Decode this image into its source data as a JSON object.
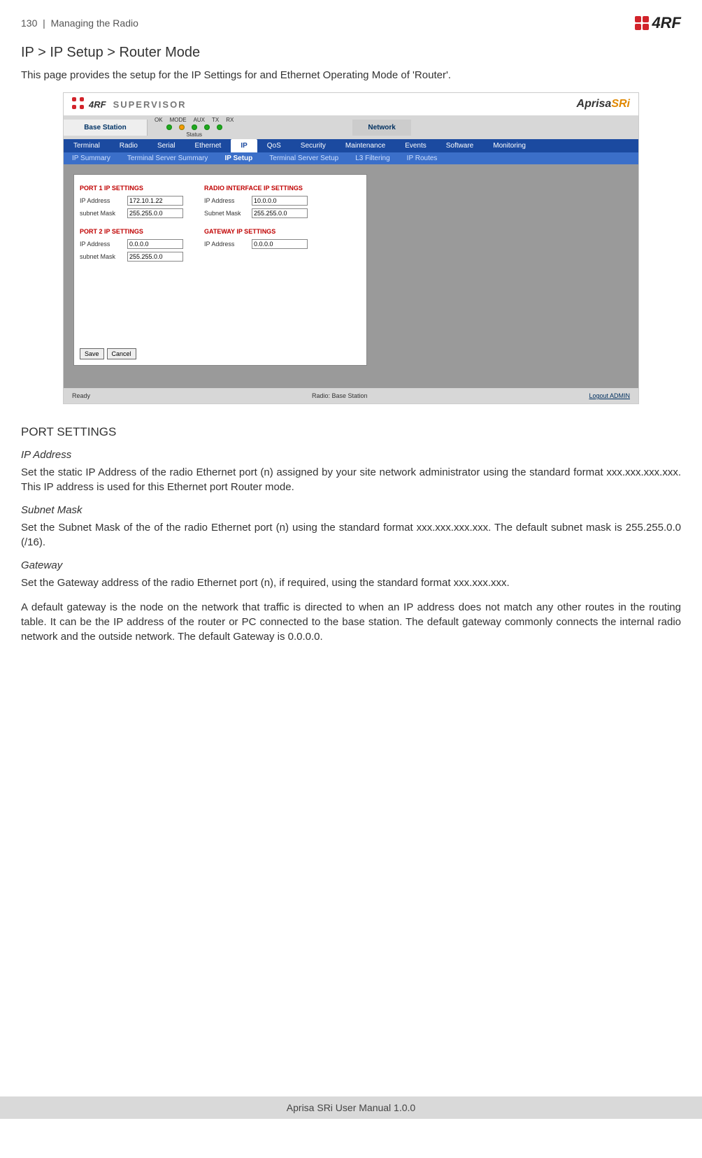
{
  "header": {
    "page_number": "130",
    "section": "Managing the Radio",
    "logo_text": "4RF"
  },
  "title": "IP > IP Setup > Router Mode",
  "intro": "This page provides the setup for the IP Settings for and Ethernet Operating Mode of 'Router'.",
  "screenshot": {
    "supervisor_label": "SUPERVISOR",
    "brand_prefix": "Aprisa",
    "brand_suffix": "SRi",
    "station_label": "Base Station",
    "status_label": "Status",
    "led_labels": [
      "OK",
      "MODE",
      "AUX",
      "TX",
      "RX"
    ],
    "network_label": "Network",
    "nav1": [
      "Terminal",
      "Radio",
      "Serial",
      "Ethernet",
      "IP",
      "QoS",
      "Security",
      "Maintenance",
      "Events",
      "Software",
      "Monitoring"
    ],
    "nav1_active_index": 4,
    "nav2": [
      "IP Summary",
      "Terminal Server Summary",
      "IP Setup",
      "Terminal Server Setup",
      "L3 Filtering",
      "IP Routes"
    ],
    "nav2_active_index": 2,
    "groups": {
      "port1_title": "PORT 1 IP SETTINGS",
      "port1_ip_label": "IP Address",
      "port1_ip_value": "172.10.1.22",
      "port1_mask_label": "subnet Mask",
      "port1_mask_value": "255.255.0.0",
      "port2_title": "PORT 2 IP SETTINGS",
      "port2_ip_label": "IP Address",
      "port2_ip_value": "0.0.0.0",
      "port2_mask_label": "subnet Mask",
      "port2_mask_value": "255.255.0.0",
      "radio_title": "RADIO INTERFACE IP SETTINGS",
      "radio_ip_label": "IP Address",
      "radio_ip_value": "10.0.0.0",
      "radio_mask_label": "Subnet Mask",
      "radio_mask_value": "255.255.0.0",
      "gateway_title": "GATEWAY IP SETTINGS",
      "gateway_ip_label": "IP Address",
      "gateway_ip_value": "0.0.0.0"
    },
    "save_btn": "Save",
    "cancel_btn": "Cancel",
    "footer_ready": "Ready",
    "footer_radio": "Radio: Base Station",
    "footer_logout": "Logout ADMIN"
  },
  "port_settings_heading": "PORT SETTINGS",
  "ip_address_heading": "IP Address",
  "ip_address_text": "Set the static IP Address of the radio Ethernet port (n) assigned by your site network administrator using the standard format xxx.xxx.xxx.xxx. This IP address is used for this Ethernet port Router mode.",
  "subnet_heading": "Subnet Mask",
  "subnet_text": "Set the Subnet Mask of the of the radio Ethernet port (n) using the standard format xxx.xxx.xxx.xxx. The default subnet mask is 255.255.0.0 (/16).",
  "gateway_heading": "Gateway",
  "gateway_text1": "Set the Gateway address of the radio Ethernet port (n), if required, using the standard format xxx.xxx.xxx.",
  "gateway_text2": "A default gateway is the node on the network that traffic is directed to when an IP address does not match any other routes in the routing table. It can be the IP address of the router or PC connected to the base station. The default gateway commonly connects the internal radio network and the outside network. The default Gateway is 0.0.0.0.",
  "footer": "Aprisa SRi User Manual 1.0.0"
}
